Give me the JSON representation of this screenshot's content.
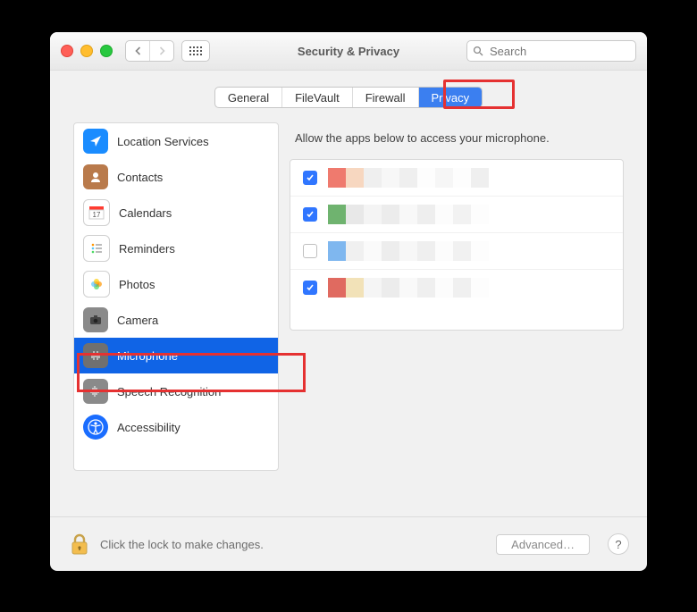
{
  "window": {
    "title": "Security & Privacy"
  },
  "search": {
    "placeholder": "Search"
  },
  "tabs": [
    {
      "label": "General"
    },
    {
      "label": "FileVault"
    },
    {
      "label": "Firewall"
    },
    {
      "label": "Privacy",
      "active": true
    }
  ],
  "sidebar": {
    "items": [
      {
        "label": "Location Services",
        "icon": "location",
        "color": "#1a8cff"
      },
      {
        "label": "Contacts",
        "icon": "contacts",
        "color": "#b97a4b"
      },
      {
        "label": "Calendars",
        "icon": "calendar",
        "color": "#ffffff"
      },
      {
        "label": "Reminders",
        "icon": "reminders",
        "color": "#ffffff"
      },
      {
        "label": "Photos",
        "icon": "photos",
        "color": "#ffffff"
      },
      {
        "label": "Camera",
        "icon": "camera",
        "color": "#8a8a8a"
      },
      {
        "label": "Microphone",
        "icon": "microphone",
        "color": "#8a8a8a",
        "selected": true
      },
      {
        "label": "Speech Recognition",
        "icon": "speech",
        "color": "#8a8a8a"
      },
      {
        "label": "Accessibility",
        "icon": "accessibility",
        "color": "#1a6dff"
      }
    ]
  },
  "right": {
    "description": "Allow the apps below to access your microphone.",
    "apps": [
      {
        "checked": true
      },
      {
        "checked": true
      },
      {
        "checked": false
      },
      {
        "checked": true
      }
    ]
  },
  "footer": {
    "lock_message": "Click the lock to make changes.",
    "advanced_label": "Advanced…"
  },
  "colors": {
    "accent": "#1064e6",
    "highlight": "#e53131"
  }
}
